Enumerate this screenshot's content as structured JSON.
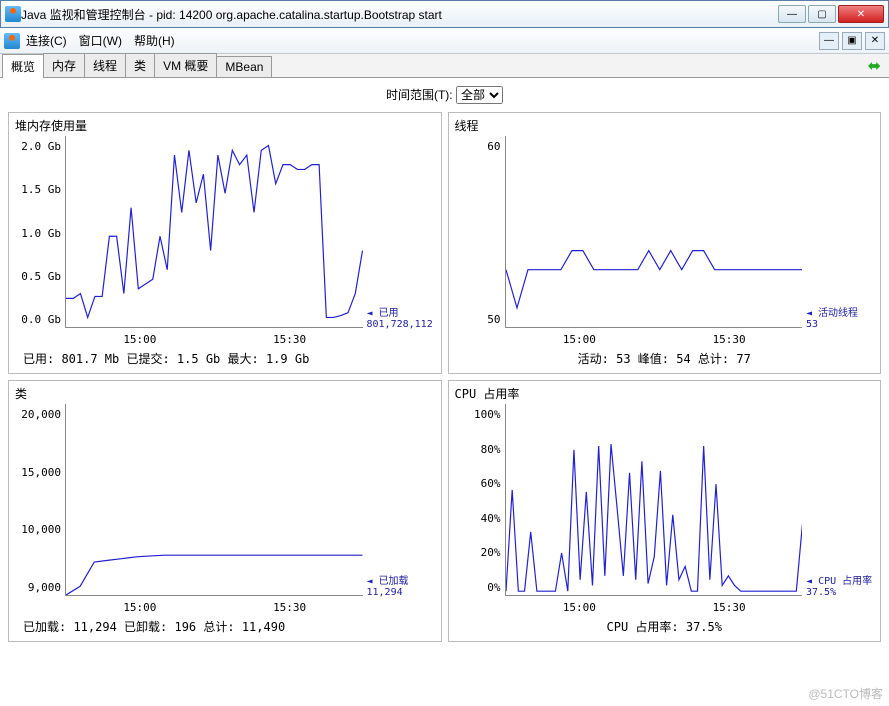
{
  "window": {
    "title": "Java 监视和管理控制台 - pid: 14200 org.apache.catalina.startup.Bootstrap start"
  },
  "menu": {
    "connect": "连接(C)",
    "window": "窗口(W)",
    "help": "帮助(H)"
  },
  "tabs": [
    "概览",
    "内存",
    "线程",
    "类",
    "VM 概要",
    "MBean"
  ],
  "active_tab": 0,
  "range": {
    "label": "时间范围(T):",
    "selected": "全部"
  },
  "panels": {
    "heap": {
      "title": "堆内存使用量",
      "legend_label": "已用",
      "legend_value": "801,728,112",
      "stats": "已用:  801.7 Mb      已提交:  1.5 Gb      最大:  1.9 Gb"
    },
    "threads": {
      "title": "线程",
      "legend_label": "活动线程",
      "legend_value": "53",
      "stats": "活动:  53       峰值:  54       总计:  77"
    },
    "classes": {
      "title": "类",
      "legend_label": "已加载",
      "legend_value": "11,294",
      "stats": "已加载:  11,294      已卸载:  196      总计:  11,490"
    },
    "cpu": {
      "title": "CPU 占用率",
      "legend_label": "CPU 占用率",
      "legend_value": "37.5%",
      "stats": "CPU 占用率:  37.5%"
    }
  },
  "chart_data": [
    {
      "type": "line",
      "name": "heap",
      "ylabel": "",
      "ylim": [
        0,
        2.0
      ],
      "yticks": [
        "2.0 Gb",
        "1.5 Gb",
        "1.0 Gb",
        "0.5 Gb",
        "0.0 Gb"
      ],
      "xticks": [
        "15:00",
        "15:30"
      ],
      "values_gb": [
        0.3,
        0.3,
        0.35,
        0.1,
        0.32,
        0.32,
        0.95,
        0.95,
        0.35,
        1.25,
        0.4,
        0.45,
        0.5,
        0.95,
        0.6,
        1.8,
        1.2,
        1.85,
        1.3,
        1.6,
        0.8,
        1.8,
        1.4,
        1.85,
        1.7,
        1.8,
        1.2,
        1.85,
        1.9,
        1.5,
        1.7,
        1.7,
        1.65,
        1.65,
        1.7,
        1.7,
        0.1,
        0.1,
        0.12,
        0.15,
        0.35,
        0.8
      ]
    },
    {
      "type": "line",
      "name": "threads",
      "ylim": [
        50,
        60
      ],
      "yticks": [
        "60",
        "50"
      ],
      "xticks": [
        "15:00",
        "15:30"
      ],
      "values": [
        53,
        51,
        53,
        53,
        53,
        53,
        54,
        54,
        53,
        53,
        53,
        53,
        53,
        54,
        53,
        54,
        53,
        54,
        54,
        53,
        53,
        53,
        53,
        53,
        53,
        53,
        53,
        53
      ]
    },
    {
      "type": "line",
      "name": "classes",
      "ylim": [
        9000,
        20000
      ],
      "yticks": [
        "20,000",
        "15,000",
        "10,000",
        "9,000"
      ],
      "xticks": [
        "15:00",
        "15:30"
      ],
      "values": [
        9000,
        9500,
        10900,
        11000,
        11100,
        11200,
        11250,
        11294,
        11294,
        11294,
        11294,
        11294,
        11294,
        11294,
        11294,
        11294,
        11294,
        11294,
        11294,
        11294,
        11294,
        11294
      ]
    },
    {
      "type": "line",
      "name": "cpu",
      "ylim": [
        0,
        100
      ],
      "yticks": [
        "100%",
        "80%",
        "60%",
        "40%",
        "20%",
        "0%"
      ],
      "xticks": [
        "15:00",
        "15:30"
      ],
      "values_pct": [
        2,
        55,
        2,
        2,
        33,
        2,
        2,
        2,
        2,
        22,
        2,
        76,
        8,
        54,
        5,
        78,
        10,
        79,
        45,
        10,
        64,
        8,
        70,
        6,
        20,
        65,
        5,
        42,
        8,
        15,
        2,
        2,
        78,
        8,
        58,
        5,
        10,
        5,
        2,
        2,
        2,
        2,
        2,
        2,
        2,
        2,
        2,
        2,
        37.5
      ]
    }
  ],
  "watermark": "@51CTO博客"
}
